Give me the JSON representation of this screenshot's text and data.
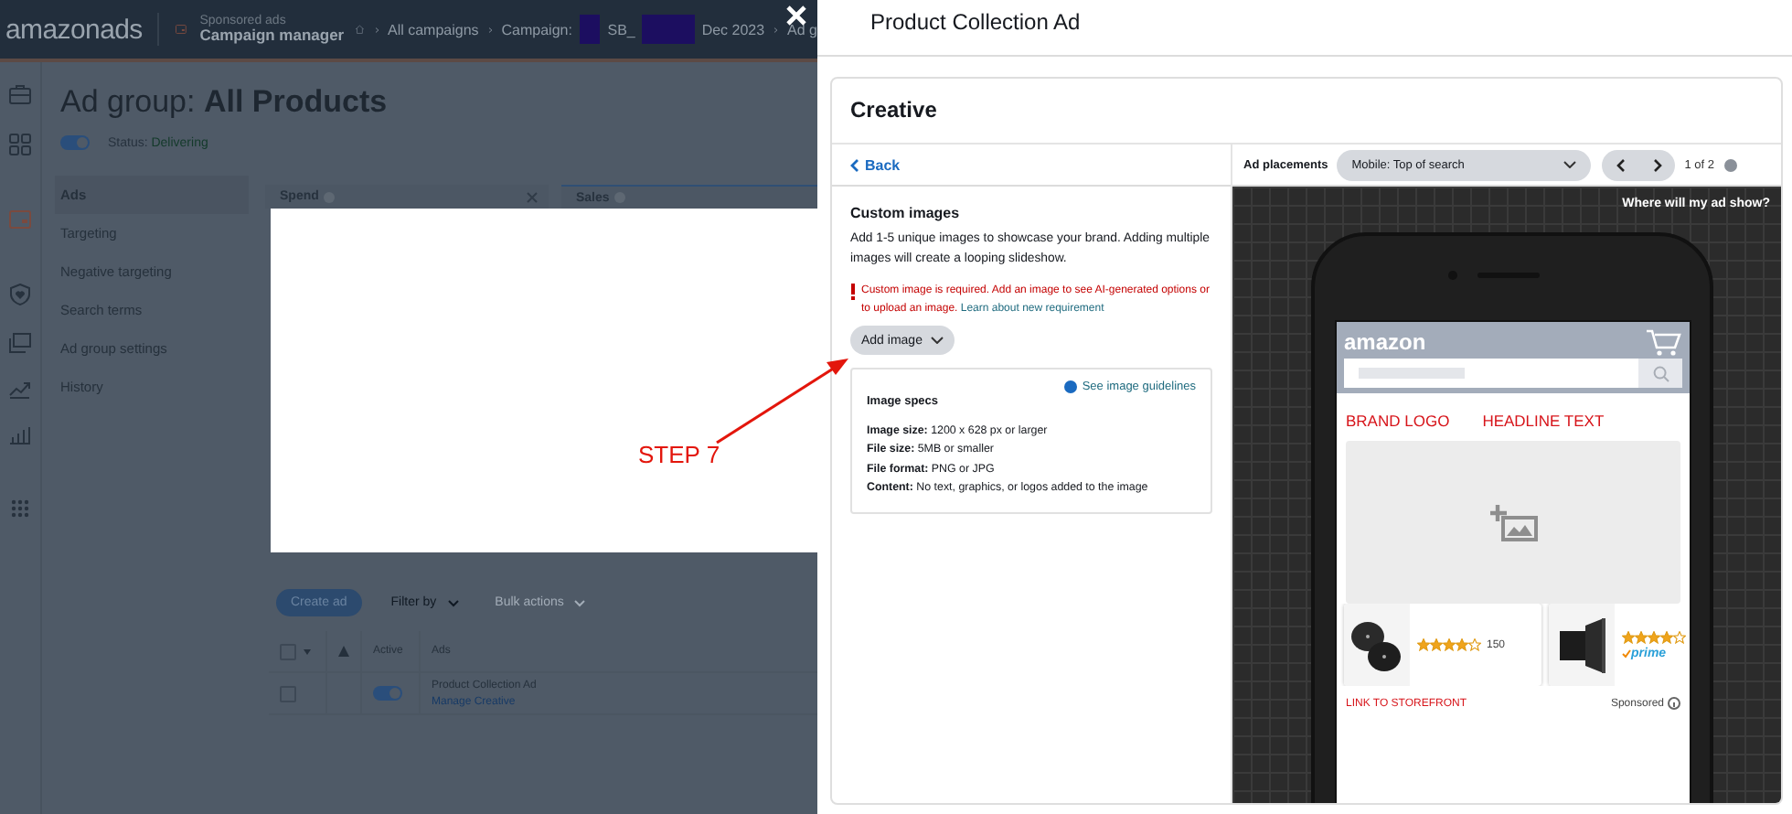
{
  "header": {
    "logo": "amazonads",
    "product_line": "Sponsored ads",
    "app_name": "Campaign manager",
    "breadcrumbs": [
      {
        "segments": [
          {
            "kind": "text",
            "text": "All campaigns"
          }
        ]
      },
      {
        "segments": [
          {
            "kind": "text",
            "text": "Campaign:"
          },
          {
            "kind": "redacted"
          },
          {
            "kind": "text",
            "text": "SB_"
          },
          {
            "kind": "redacted"
          },
          {
            "kind": "text",
            "text": "Dec 2023"
          }
        ]
      },
      {
        "segments": [
          {
            "kind": "text",
            "text": "Ad g"
          }
        ]
      }
    ]
  },
  "page": {
    "title_prefix": "Ad group:",
    "title": "All Products",
    "status": {
      "on": true,
      "label": "Status:",
      "value": "Delivering"
    }
  },
  "side_nav": [
    {
      "label": "Ads",
      "selected": true
    },
    {
      "label": "Targeting",
      "selected": false
    },
    {
      "label": "Negative targeting",
      "selected": false
    },
    {
      "label": "Search terms",
      "selected": false
    },
    {
      "label": "Ad group settings",
      "selected": false
    },
    {
      "label": "History",
      "selected": false
    }
  ],
  "metric_tabs": [
    {
      "label": "Spend",
      "selected": false,
      "closable": true
    },
    {
      "label": "Sales",
      "selected": true,
      "closable": false
    }
  ],
  "toolbar": {
    "create_button": "Create ad",
    "dropdowns": [
      {
        "label": "Filter by",
        "disabled": false
      },
      {
        "label": "Bulk actions",
        "disabled": true
      }
    ]
  },
  "table": {
    "header_checked": false,
    "columns": [
      "Active",
      "Ads"
    ],
    "rows": [
      {
        "checked": false,
        "active": true,
        "ad": "Product Collection Ad",
        "link": "Manage Creative"
      }
    ]
  },
  "annotation": {
    "text": "STEP 7"
  },
  "drawer": {
    "title": "Product Collection Ad",
    "section": "Creative",
    "back": "Back",
    "custom_images": {
      "title": "Custom images",
      "description": "Add 1-5 unique images to showcase your brand. Adding multiple images will create a looping slideshow.",
      "error": "Custom image is required. Add an image to see AI-generated options or to upload an image.",
      "error_link": "Learn about new requirement",
      "add_button": "Add image",
      "guidelines_link": "See image guidelines",
      "specs_title": "Image specs",
      "specs": [
        "**Image size:** 1200 x 628 px or larger",
        "**File size:** 5MB or smaller",
        "**File format:** PNG or JPG",
        "**Content:** No text, graphics, or logos added to the image"
      ]
    },
    "preview": {
      "label": "Ad placements",
      "placement": "Mobile: Top of search",
      "pager": "1 of 2",
      "hint": "Where will my ad show?",
      "mock": {
        "logo": "amazon",
        "brand": "BRAND LOGO",
        "headline": "HEADLINE TEXT",
        "link": "LINK TO STOREFRONT",
        "sponsored": "Sponsored",
        "products": [
          {
            "stars": 4,
            "count": "150",
            "prime": false
          },
          {
            "stars": 4,
            "prime": true,
            "prime_label": "prime"
          }
        ]
      }
    }
  }
}
